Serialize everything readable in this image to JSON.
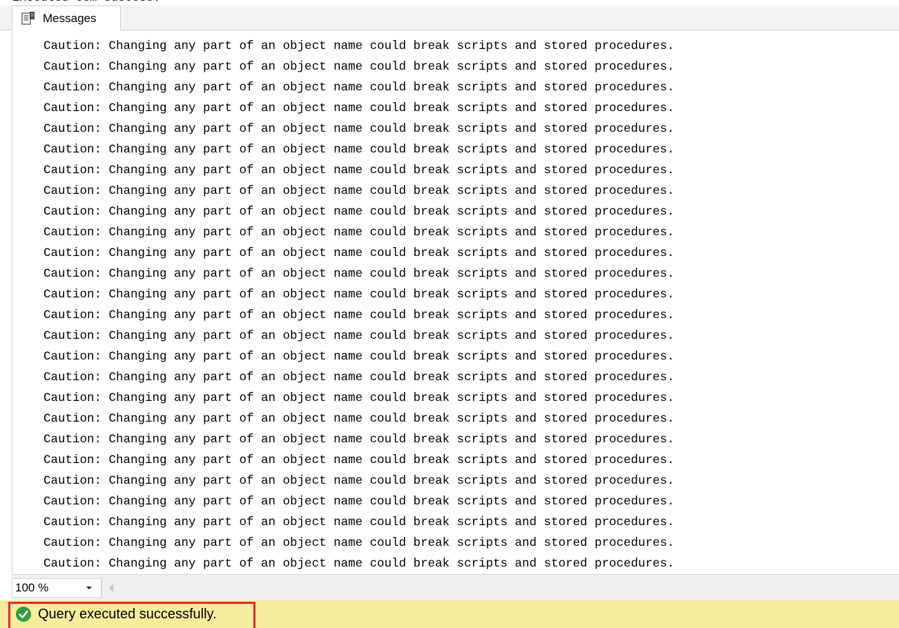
{
  "top_partial_text": "Executed com success.",
  "tab": {
    "label": "Messages",
    "icon": "messages-icon"
  },
  "messages": [
    "Caution: Changing any part of an object name could break scripts and stored procedures.",
    "Caution: Changing any part of an object name could break scripts and stored procedures.",
    "Caution: Changing any part of an object name could break scripts and stored procedures.",
    "Caution: Changing any part of an object name could break scripts and stored procedures.",
    "Caution: Changing any part of an object name could break scripts and stored procedures.",
    "Caution: Changing any part of an object name could break scripts and stored procedures.",
    "Caution: Changing any part of an object name could break scripts and stored procedures.",
    "Caution: Changing any part of an object name could break scripts and stored procedures.",
    "Caution: Changing any part of an object name could break scripts and stored procedures.",
    "Caution: Changing any part of an object name could break scripts and stored procedures.",
    "Caution: Changing any part of an object name could break scripts and stored procedures.",
    "Caution: Changing any part of an object name could break scripts and stored procedures.",
    "Caution: Changing any part of an object name could break scripts and stored procedures.",
    "Caution: Changing any part of an object name could break scripts and stored procedures.",
    "Caution: Changing any part of an object name could break scripts and stored procedures.",
    "Caution: Changing any part of an object name could break scripts and stored procedures.",
    "Caution: Changing any part of an object name could break scripts and stored procedures.",
    "Caution: Changing any part of an object name could break scripts and stored procedures.",
    "Caution: Changing any part of an object name could break scripts and stored procedures.",
    "Caution: Changing any part of an object name could break scripts and stored procedures.",
    "Caution: Changing any part of an object name could break scripts and stored procedures.",
    "Caution: Changing any part of an object name could break scripts and stored procedures.",
    "Caution: Changing any part of an object name could break scripts and stored procedures.",
    "Caution: Changing any part of an object name could break scripts and stored procedures.",
    "Caution: Changing any part of an object name could break scripts and stored procedures.",
    "Caution: Changing any part of an object name could break scripts and stored procedures."
  ],
  "zoom": {
    "value": "100 %"
  },
  "status": {
    "text": "Query executed successfully.",
    "icon": "check-circle-icon",
    "colors": {
      "bar_background": "#f5ec9c",
      "highlight_border": "#e8262b",
      "icon_green": "#2f9e44"
    }
  }
}
